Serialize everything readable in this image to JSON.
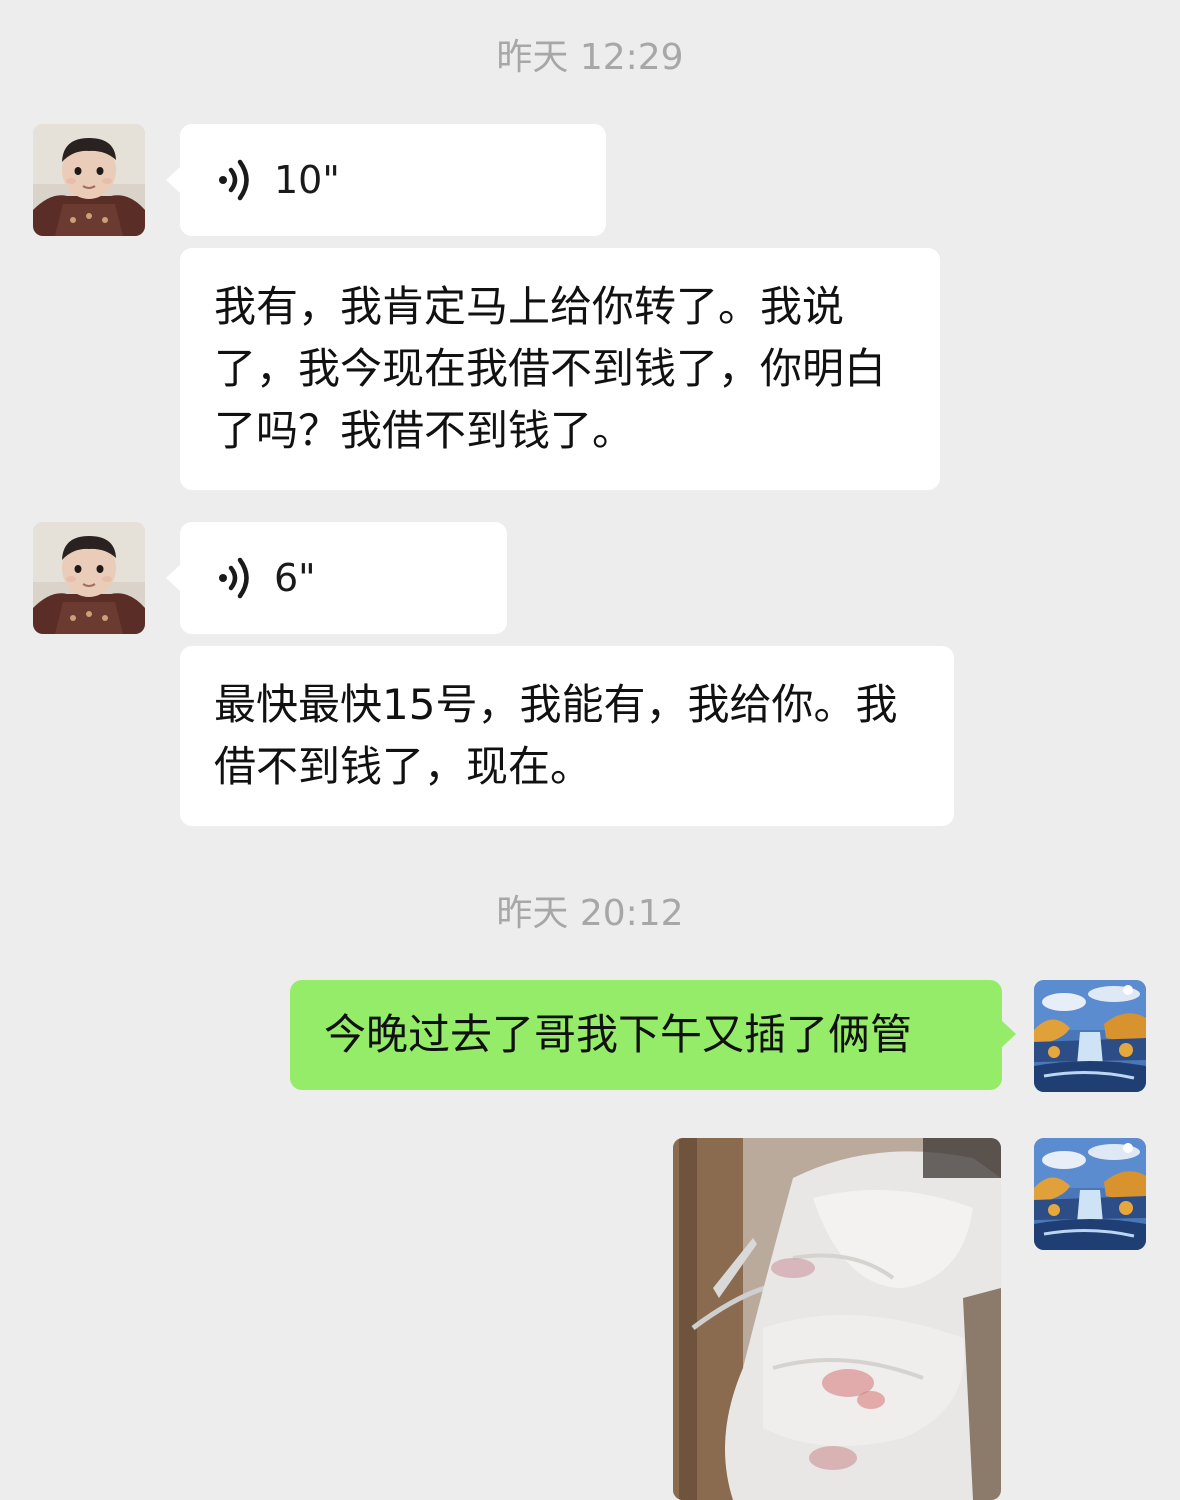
{
  "chat": {
    "timestamps": [
      "昨天 12:29",
      "昨天 20:12"
    ],
    "messages": [
      {
        "type": "voice",
        "sender": "contact",
        "duration": "10\""
      },
      {
        "type": "text",
        "sender": "contact",
        "text": "我有，我肯定马上给你转了。我说了，我今现在我借不到钱了，你明白了吗？我借不到钱了。"
      },
      {
        "type": "voice",
        "sender": "contact",
        "duration": "6\""
      },
      {
        "type": "text",
        "sender": "contact",
        "text": "最快最快15号，我能有，我给你。我借不到钱了，现在。"
      },
      {
        "type": "text",
        "sender": "me",
        "text": "今晚过去了哥我下午又插了俩管"
      },
      {
        "type": "image",
        "sender": "me"
      }
    ]
  },
  "colors": {
    "background": "#ededed",
    "incoming_bubble": "#ffffff",
    "outgoing_bubble": "#95ec69",
    "timestamp_text": "#a7a7a7"
  },
  "icons": {
    "voice": "voice-wave-icon",
    "contact_avatar": "baby-avatar",
    "user_avatar": "waterfall-landscape-avatar"
  }
}
